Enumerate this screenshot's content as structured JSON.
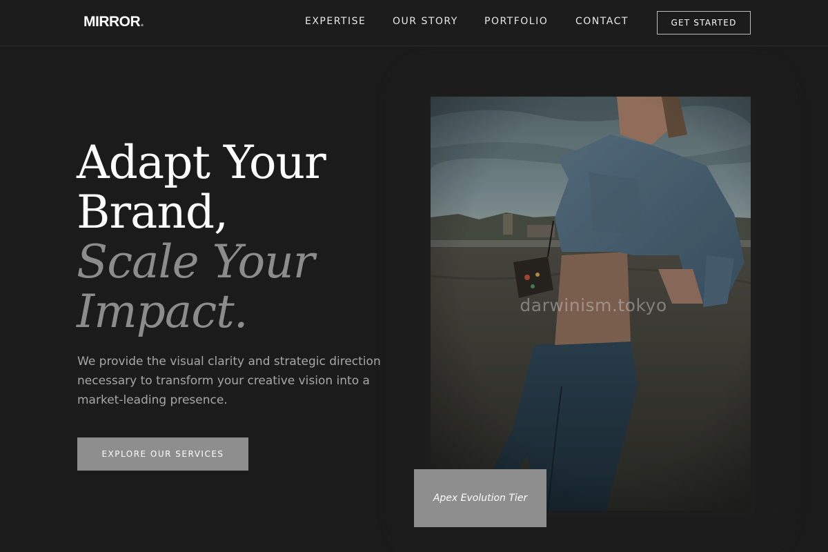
{
  "brand": {
    "logo": "MIRROR",
    "logo_dot": "."
  },
  "nav": {
    "items": [
      "EXPERTISE",
      "OUR STORY",
      "PORTFOLIO",
      "CONTACT"
    ],
    "cta": "GET STARTED"
  },
  "hero": {
    "title_line1": "Adapt Your",
    "title_line2": "Brand,",
    "title_line3": "Scale Your",
    "title_line4": "Impact.",
    "description": "We provide the visual clarity and strategic direction necessary to transform your creative vision into a market-leading presence.",
    "button": "EXPLORE OUR SERVICES"
  },
  "image": {
    "icon": "photo-woman-denim",
    "watermark": "darwinism.tokyo",
    "badge": "Apex Evolution Tier"
  },
  "colors": {
    "background": "#1b1b1b",
    "accent_gray": "#8e8e8e",
    "text_muted": "#a7a7a7"
  }
}
